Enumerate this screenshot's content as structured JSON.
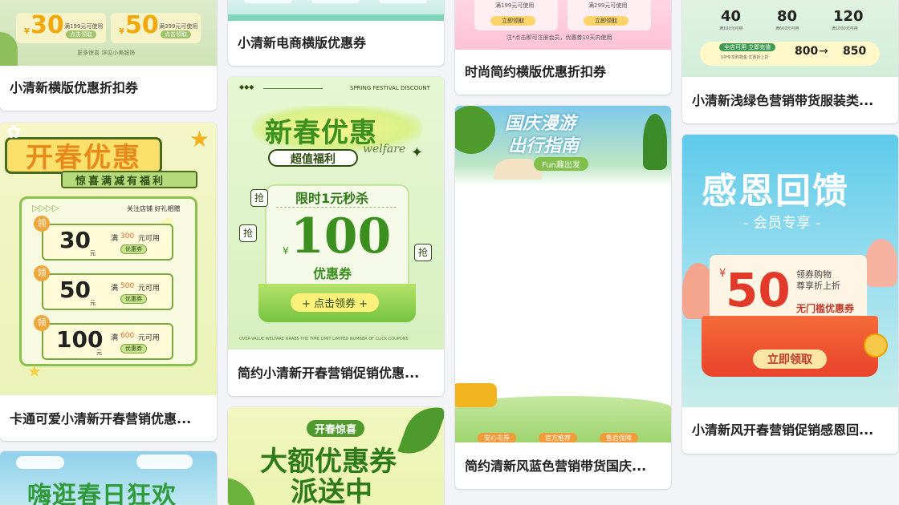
{
  "cards": {
    "c1": {
      "title": "小清新横版优惠折扣券",
      "coupon1_amount": "30",
      "coupon1_cond": "满199元可使用",
      "coupon1_btn": "点击领取",
      "coupon2_amount": "50",
      "coupon2_cond": "满399元可使用",
      "coupon2_btn": "点击领取",
      "footer": "更多惊喜 详见小美服饰"
    },
    "c2": {
      "title": "卡通可爱小清新开春营销优惠...",
      "headline": "开春优惠",
      "sub": "惊喜满减有福利",
      "follow": "关注店铺 好礼相赠",
      "grab": "领",
      "unit": "元",
      "full": "满",
      "use": "元可用",
      "tag": "优惠券",
      "coupons": [
        {
          "amount": "30",
          "threshold": "300"
        },
        {
          "amount": "50",
          "threshold": "500"
        },
        {
          "amount": "100",
          "threshold": "600"
        }
      ]
    },
    "c3": {
      "title": "小清新电商横版优惠券"
    },
    "c4": {
      "title": "简约小清新开春营销促销优惠...",
      "top_text": "SPRING FESTIVAL DISCOUNT",
      "headline": "新春优惠",
      "sub": "超值福利",
      "script": "welfare",
      "flash": "限时1元秒杀",
      "currency": "¥",
      "amount": "100",
      "coupon": "优惠券",
      "btn": "+ 点击领券 +",
      "grab": "抢",
      "bottom_text": "OVER-VALUE WELFARE GRABS THE TIME LIMIT LIMITED NUMBER OF CLICK COUPONS"
    },
    "c5": {
      "headline1": "开春惊喜",
      "headline2": "大额优惠券",
      "headline3": "派送中"
    },
    "c6": {
      "title": "时尚简约横版优惠折扣券",
      "cond1": "满199元可使用",
      "btn1": "立即领取",
      "cond2": "满299元可使用",
      "btn2": "立即领取",
      "note": "注*点击即可注册会员，优惠券10天内使用"
    },
    "c7": {
      "title": "简约清新风蓝色营销带货国庆...",
      "headline1": "国庆漫游",
      "headline2": "出行指南",
      "sub": "Fun趣出发",
      "tags": [
        "安心屯券",
        "官方推荐",
        "售后保障"
      ]
    },
    "c8": {
      "title": "小清新浅绿色营销带货服装类...",
      "amounts": [
        "40",
        "80",
        "120"
      ],
      "conds": [
        "满100元可用",
        "满600元可用",
        "满1000元可用"
      ],
      "bar1": "全店可用 立即充值",
      "bar2": "VIP专享购物金 优惠折上折",
      "from": "800",
      "to": "850"
    },
    "c9": {
      "title": "小清新风开春营销促销感恩回...",
      "headline": "感恩回馈",
      "sub": "- 会员专享 -",
      "currency": "¥",
      "amount": "50",
      "line1": "领券购物",
      "line2": "尊享折上折",
      "type": "无门槛优惠券",
      "btn": "立即领取"
    },
    "c10": {
      "headline": "嗨逛春日狂欢"
    }
  }
}
